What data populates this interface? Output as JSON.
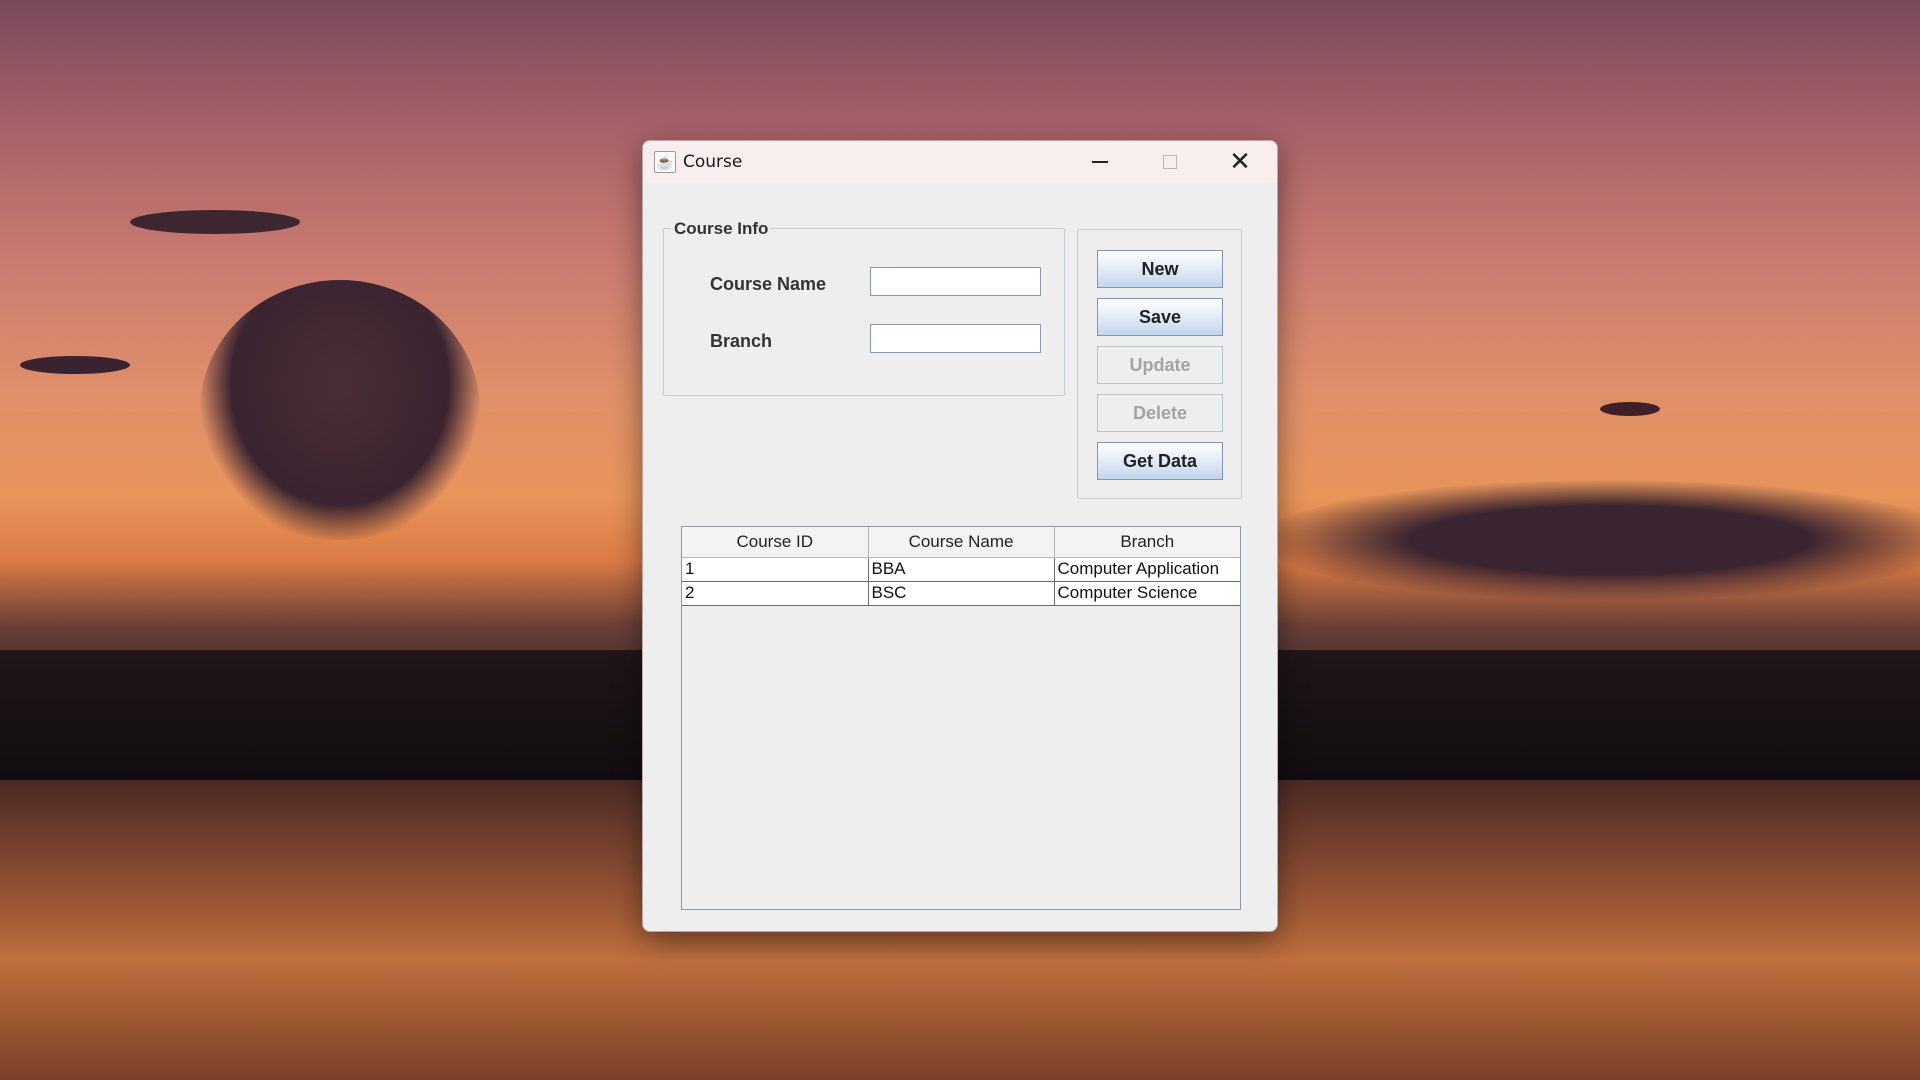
{
  "window": {
    "title": "Course",
    "app_icon": "java-cup-icon"
  },
  "course_info": {
    "group_title": "Course Info",
    "course_name_label": "Course Name",
    "course_name_value": "",
    "branch_label": "Branch",
    "branch_value": ""
  },
  "buttons": {
    "new": "New",
    "save": "Save",
    "update": "Update",
    "delete": "Delete",
    "get_data": "Get Data"
  },
  "table": {
    "columns": [
      "Course ID",
      "Course Name",
      "Branch"
    ],
    "rows": [
      [
        "1",
        "BBA",
        "Computer Application"
      ],
      [
        "2",
        "BSC",
        "Computer Science"
      ]
    ]
  },
  "colors": {
    "button_enabled": "#c4d6ec",
    "button_disabled_text": "#a3a3a3",
    "window_bg": "#eeeeee"
  }
}
